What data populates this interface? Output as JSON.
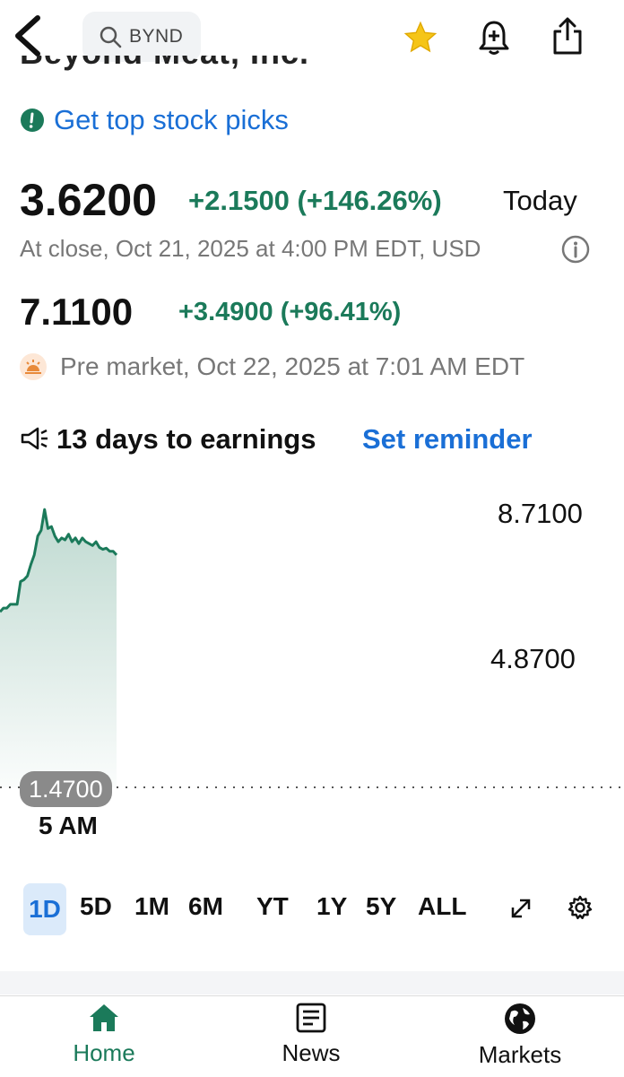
{
  "header": {
    "search_ticker": "BYND",
    "company_name": "Beyond Meat, Inc."
  },
  "promo": {
    "label": "Get top stock picks"
  },
  "quote": {
    "price": "3.6200",
    "change": "+2.1500 (+146.26%)",
    "period": "Today",
    "close_meta": "At close, Oct 21, 2025 at 4:00 PM EDT, USD"
  },
  "premarket": {
    "price": "7.1100",
    "change": "+3.4900 (+96.41%)",
    "meta": "Pre market, Oct 22, 2025 at 7:01 AM EDT"
  },
  "earnings": {
    "text": "13 days to earnings",
    "action": "Set reminder"
  },
  "chart_data": {
    "type": "area",
    "y_ticks": [
      "8.7100",
      "4.8700"
    ],
    "previous_close": "1.4700",
    "x_ticks": [
      "5 AM"
    ],
    "ylim": [
      1.47,
      8.71
    ],
    "series": [
      {
        "values": [
          6.1,
          6.2,
          6.2,
          6.3,
          6.3,
          6.3,
          6.9,
          6.95,
          7.05,
          7.35,
          7.6,
          8.1,
          8.25,
          8.8,
          8.3,
          8.35,
          8.1,
          7.95,
          8.05,
          8.0,
          8.15,
          7.95,
          8.05,
          7.9,
          8.05,
          7.95,
          7.9,
          7.85,
          7.95,
          7.8,
          7.75,
          7.78,
          7.7,
          7.7,
          7.6
        ]
      }
    ],
    "color": "#1b7a5a"
  },
  "ranges": [
    "1D",
    "5D",
    "1M",
    "6M",
    "YT",
    "1Y",
    "5Y",
    "ALL"
  ],
  "active_range": "1D",
  "tabs": [
    {
      "label": "Home",
      "icon": "home-icon"
    },
    {
      "label": "News",
      "icon": "news-icon"
    },
    {
      "label": "Markets",
      "icon": "globe-icon"
    }
  ],
  "colors": {
    "accent_green": "#1b7a5a",
    "link_blue": "#1a6fd6"
  }
}
